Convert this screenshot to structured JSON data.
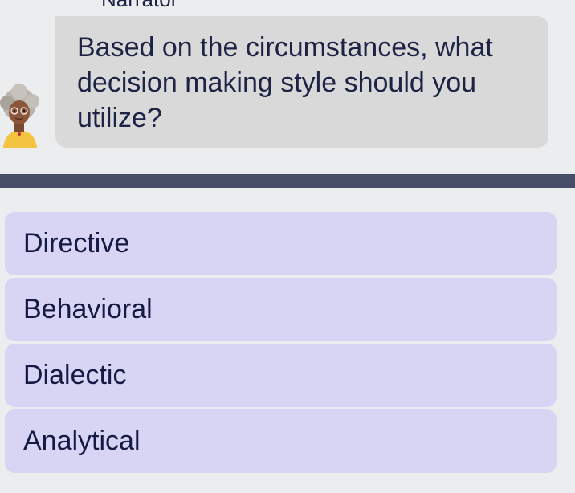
{
  "dialogue": {
    "speaker": "Narrator",
    "prompt": "Based on the circumstances, what decision making style should you utilize?",
    "avatar_icon": "narrator-avatar"
  },
  "choices": [
    {
      "label": "Directive"
    },
    {
      "label": "Behavioral"
    },
    {
      "label": "Dialectic"
    },
    {
      "label": "Analytical"
    }
  ],
  "colors": {
    "background": "#ecedef",
    "bubble": "#d9d9da",
    "divider": "#464d66",
    "choice_bg": "#d8d5f4",
    "text": "#1c2344"
  }
}
